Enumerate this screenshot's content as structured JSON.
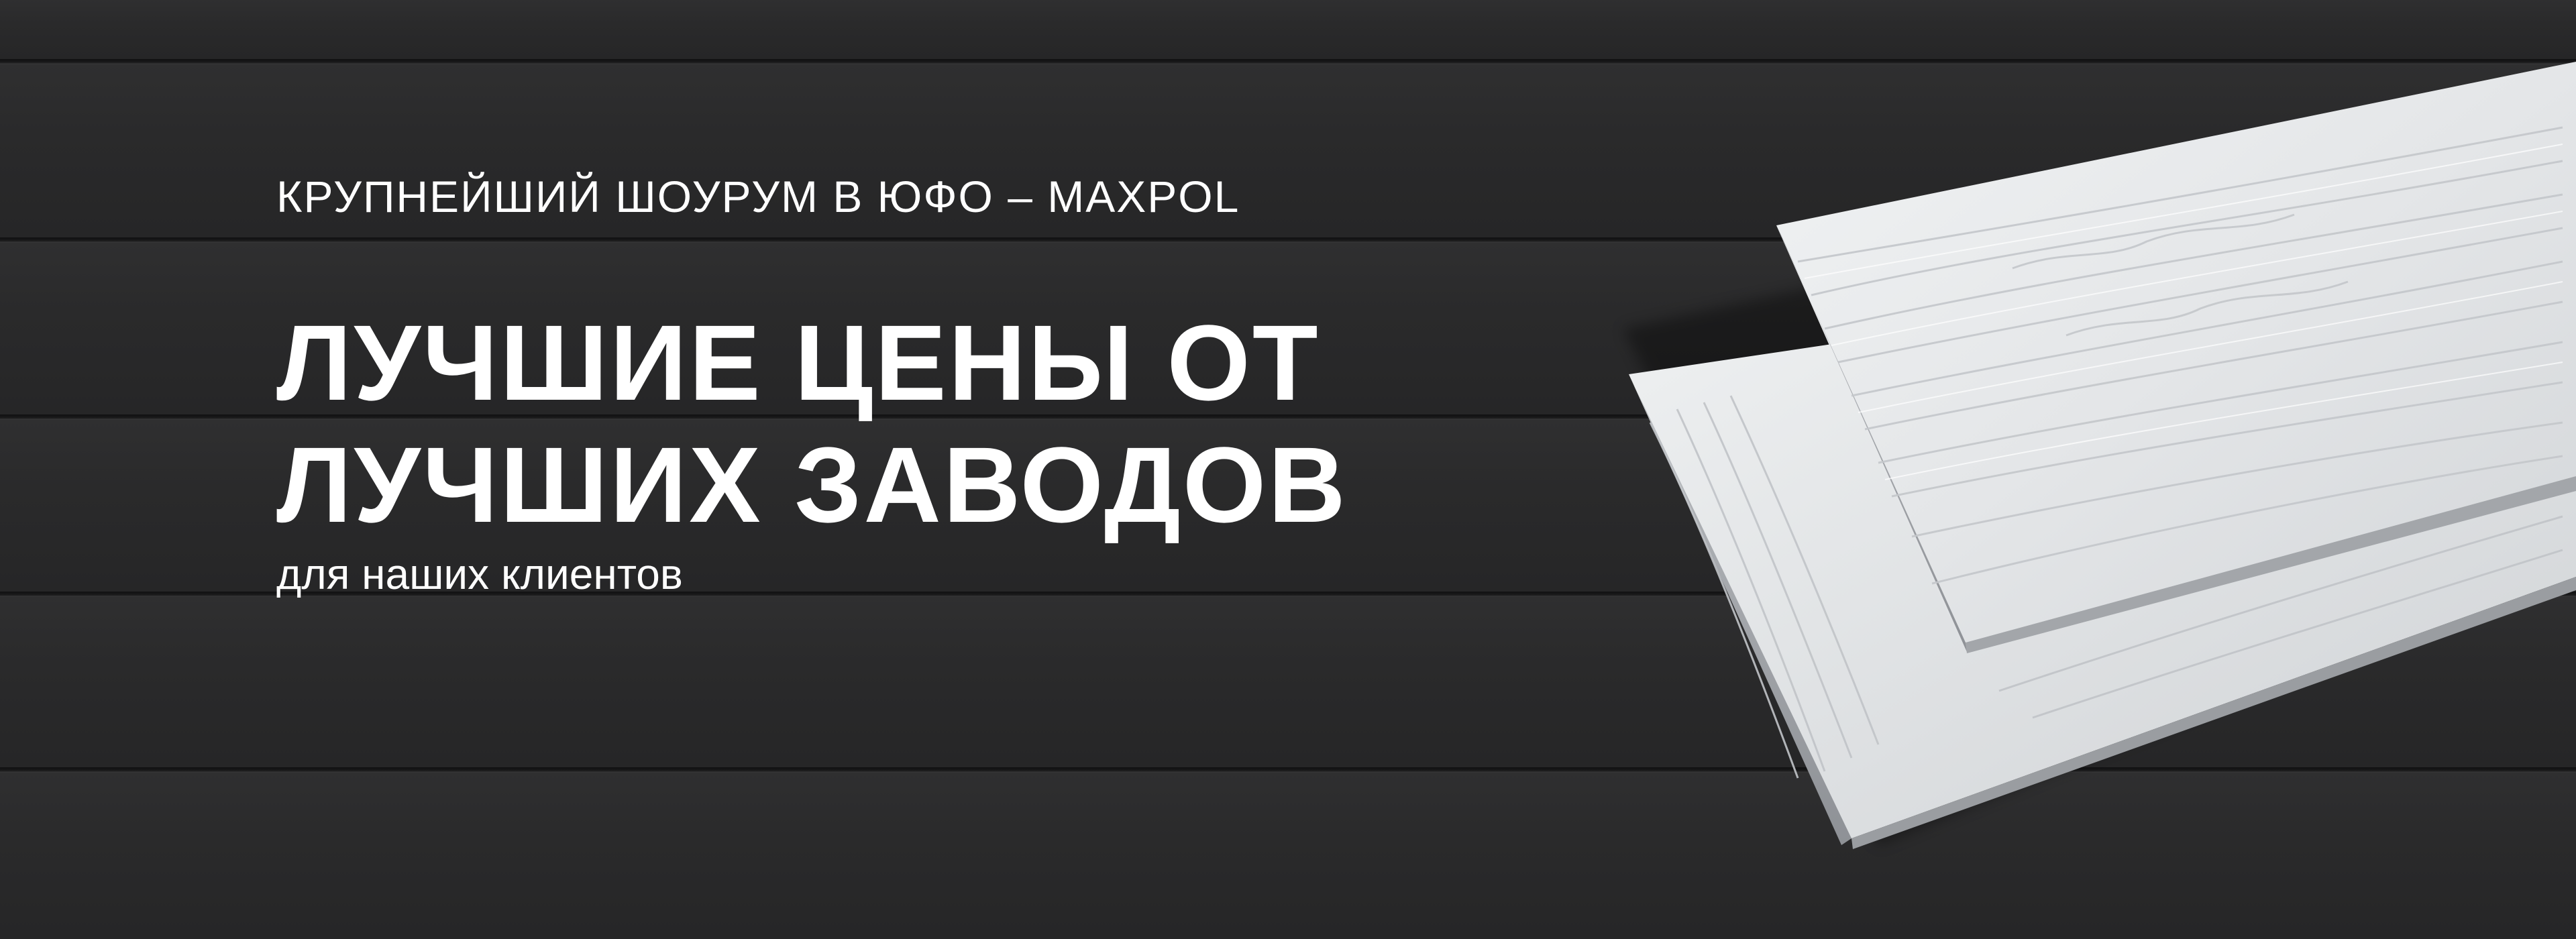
{
  "banner": {
    "eyebrow": "КРУПНЕЙШИЙ ШОУРУМ В ЮФО – MAXPOL",
    "headline_line1": "ЛУЧШИЕ ЦЕНЫ ОТ",
    "headline_line2": "ЛУЧШИХ ЗАВОДОВ",
    "subline": "для наших клиентов"
  },
  "colors": {
    "background": "#2a2a2b",
    "text": "#ffffff",
    "board": "#e9ebed"
  }
}
